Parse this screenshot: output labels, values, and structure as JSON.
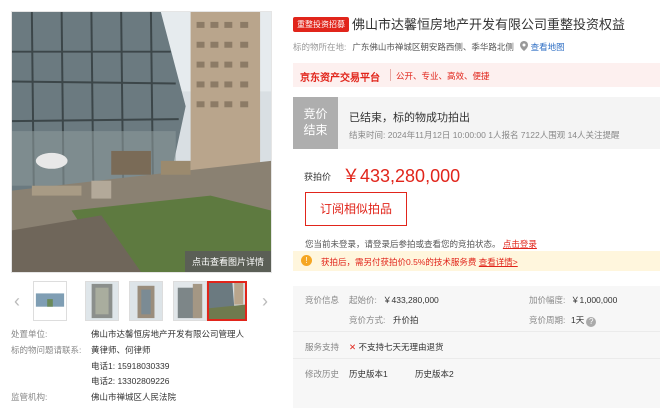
{
  "gallery": {
    "view_details": "点击查看图片详情",
    "prev": "‹",
    "next": "›",
    "thumb_count": 5,
    "active_thumb": 5
  },
  "info": [
    {
      "label": "处置单位:",
      "value": "佛山市达馨恒房地产开发有限公司管理人"
    },
    {
      "label": "标的物问题请联系:",
      "value": "黄律师、何律师"
    },
    {
      "label": "",
      "value": "电话1:  15918030339"
    },
    {
      "label": "",
      "value": "电话2:  13302809226"
    },
    {
      "label": "监管机构:",
      "value": "佛山市禅城区人民法院"
    }
  ],
  "header": {
    "tag": "重整投资招募",
    "title": "佛山市达馨恒房地产开发有限公司重整投资权益",
    "location_label": "标的物所在地:",
    "location_value": "广东佛山市禅城区朝安路西侧、季华路北侧",
    "map_link": "查看地图"
  },
  "platform": {
    "brand": "京东资产交易平台",
    "slogan": "公开、专业、高效、便捷"
  },
  "status": {
    "badge_line1": "竞价",
    "badge_line2": "结束",
    "text": "已结束，标的物成功拍出",
    "meta": "结束时间:  2024年11月12日 10:00:00     1人报名     7122人围观     14人关注提醒"
  },
  "price": {
    "label": "获拍价",
    "value": "￥433,280,000",
    "subscribe_button": "订阅相似拍品"
  },
  "login_tip": {
    "text": "您当前未登录，请登录后参拍或查看您的竞拍状态。",
    "link": "点击登录"
  },
  "fee": {
    "icon": "!",
    "text": "获拍后，需另付获拍价0.5%的技术服务费",
    "link": "查看详情>"
  },
  "details": {
    "price_info_label": "竞价信息",
    "start_price_label": "起始价:",
    "start_price": "￥433,280,000",
    "increment_label": "加价幅度:",
    "increment": "￥1,000,000",
    "method_label": "竞价方式:",
    "method": "升价拍",
    "period_label": "竞价周期:",
    "period": "1天",
    "period_help": "?",
    "service_label": "服务支持",
    "service_icon": "✕",
    "service_text": "不支持七天无理由退货",
    "history_label": "修改历史",
    "history_v1": "历史版本1",
    "history_v2": "历史版本2"
  },
  "colors": {
    "accent": "#e1251b",
    "status_badge": "#aeaeae",
    "link": "#2f6fc4"
  }
}
